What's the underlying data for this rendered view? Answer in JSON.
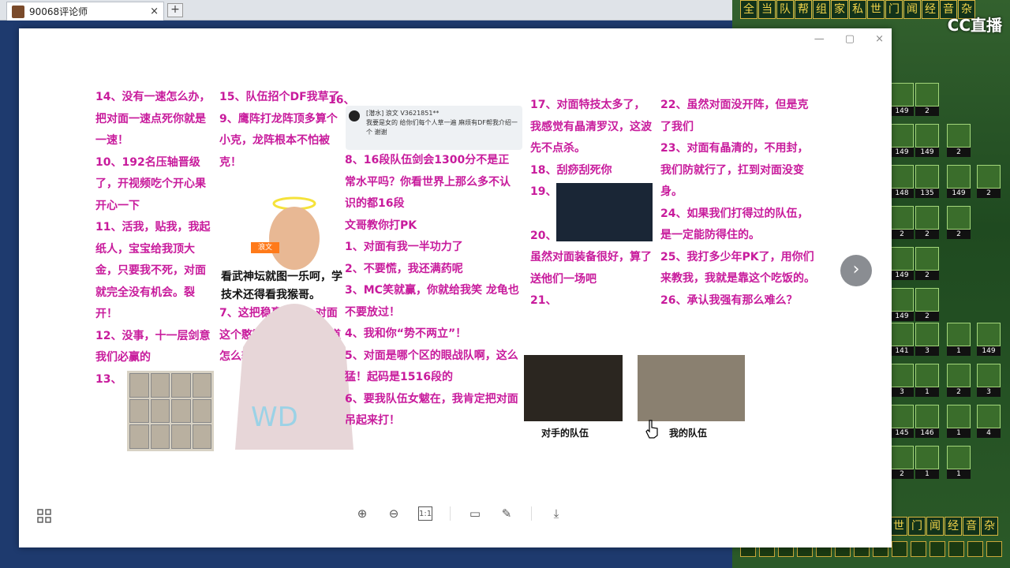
{
  "browser": {
    "tab_title": "90068评论师",
    "tab_close": "×",
    "new_tab": "+"
  },
  "game": {
    "top_buttons": [
      "全",
      "当",
      "队",
      "帮",
      "组",
      "家",
      "私",
      "世",
      "门",
      "闻",
      "经",
      "音",
      "杂"
    ],
    "bottom_buttons": [
      "世",
      "门",
      "闻",
      "经",
      "音",
      "杂"
    ],
    "logo": "CC直播",
    "slots": [
      {
        "n": "149"
      },
      {
        "n": "2"
      },
      {
        "n": "149"
      },
      {
        "n": "149"
      },
      {
        "n": "2"
      },
      {
        "n": "148"
      },
      {
        "n": "135"
      },
      {
        "n": "149"
      },
      {
        "n": "2"
      },
      {
        "n": "2"
      },
      {
        "n": "2"
      },
      {
        "n": "2"
      },
      {
        "n": "149"
      },
      {
        "n": "2"
      },
      {
        "n": "149"
      },
      {
        "n": "2"
      },
      {
        "n": "141"
      },
      {
        "n": "3"
      },
      {
        "n": "1"
      },
      {
        "n": "149"
      },
      {
        "n": "3"
      },
      {
        "n": "1"
      },
      {
        "n": "2"
      },
      {
        "n": "3"
      },
      {
        "n": "145"
      },
      {
        "n": "146"
      },
      {
        "n": "1"
      },
      {
        "n": "4"
      },
      {
        "n": "2"
      },
      {
        "n": "1"
      },
      {
        "n": "1"
      }
    ]
  },
  "viewer": {
    "controls": [
      "—",
      "▢",
      "×"
    ],
    "next_label": "›",
    "toolbar": [
      "⊕",
      "⊖",
      "1:1",
      "▭",
      "✎",
      "⤓"
    ]
  },
  "content": {
    "col1": [
      "14、没有一速怎么办，把对面一速点死你就是一速！",
      "10、192名压轴晋级了，开视频吃个开心果开心一下",
      "11、活我，贴我，我起纸人，宝宝给我顶大金，只要我不死，对面就完全没有机会。裂开！",
      "12、没事，十一层剑意我们必赢的",
      "13、"
    ],
    "col2": [
      "15、队伍招个DF我草了",
      "9、鹰阵打龙阵顶多算个小克，龙阵根本不怕被克！",
      "",
      "",
      "",
      "7、这把稳赢的局，对面这个憨憨阵容我都不知道怎么输"
    ],
    "col3_top": "16、",
    "chat": {
      "header": "[潜水] 浪文 V3621851**",
      "body": "我要是女的 给你们每个人草一遍 麻烦有DF帮我介绍一个 谢谢"
    },
    "col3": [
      "8、16段队伍剑会1300分不是正常水平吗？你看世界上那么多不认识的都16段",
      "文哥教你打PK",
      "1、对面有我一半功力了",
      "2、不要慌，我还满药呢",
      "3、MC笑就赢，你就给我笑  龙龟也不要放过！",
      "4、我和你“势不两立”！",
      "5、对面是哪个区的眼战队啊，这么猛！起码是1516段的",
      "6、要我队伍女魃在，我肯定把对面吊起来打！"
    ],
    "col4": [
      "17、对面特技太多了，我感觉有晶清罗汉，这波先不点杀。",
      "18、刮痧刮死你",
      "19、",
      "",
      "20、这场就是运气局，虽然对面装备很好，算了送他们一场吧",
      "21、"
    ],
    "col5": [
      "22、虽然对面没开阵，但是克了我们",
      "23、对面有晶清的，不用封，我们防就行了，扛到对面没变身。",
      "24、如果我们打得过的队伍，是一定能防得住的。",
      "25、我打多少年PK了，用你们来教我，我就是靠这个吃饭的。",
      "26、承认我强有那么难么？"
    ],
    "overlay": "看武神坛就图一乐呵，学技术还得看我猴哥。",
    "tag": "浪文",
    "captions": {
      "left": "对手的队伍",
      "right": "我的队伍"
    }
  }
}
